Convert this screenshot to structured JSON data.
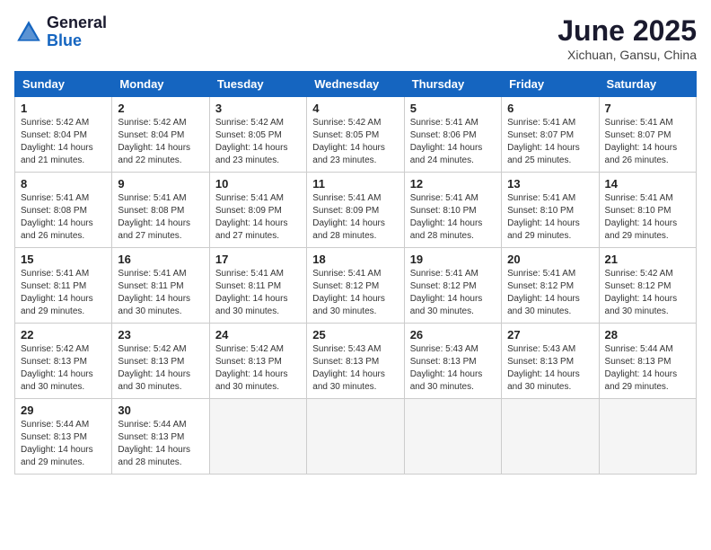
{
  "logo": {
    "general": "General",
    "blue": "Blue"
  },
  "title": "June 2025",
  "location": "Xichuan, Gansu, China",
  "weekdays": [
    "Sunday",
    "Monday",
    "Tuesday",
    "Wednesday",
    "Thursday",
    "Friday",
    "Saturday"
  ],
  "weeks": [
    [
      {
        "day": "1",
        "sunrise": "5:42 AM",
        "sunset": "8:04 PM",
        "daylight": "14 hours and 21 minutes."
      },
      {
        "day": "2",
        "sunrise": "5:42 AM",
        "sunset": "8:04 PM",
        "daylight": "14 hours and 22 minutes."
      },
      {
        "day": "3",
        "sunrise": "5:42 AM",
        "sunset": "8:05 PM",
        "daylight": "14 hours and 23 minutes."
      },
      {
        "day": "4",
        "sunrise": "5:42 AM",
        "sunset": "8:05 PM",
        "daylight": "14 hours and 23 minutes."
      },
      {
        "day": "5",
        "sunrise": "5:41 AM",
        "sunset": "8:06 PM",
        "daylight": "14 hours and 24 minutes."
      },
      {
        "day": "6",
        "sunrise": "5:41 AM",
        "sunset": "8:07 PM",
        "daylight": "14 hours and 25 minutes."
      },
      {
        "day": "7",
        "sunrise": "5:41 AM",
        "sunset": "8:07 PM",
        "daylight": "14 hours and 26 minutes."
      }
    ],
    [
      {
        "day": "8",
        "sunrise": "5:41 AM",
        "sunset": "8:08 PM",
        "daylight": "14 hours and 26 minutes."
      },
      {
        "day": "9",
        "sunrise": "5:41 AM",
        "sunset": "8:08 PM",
        "daylight": "14 hours and 27 minutes."
      },
      {
        "day": "10",
        "sunrise": "5:41 AM",
        "sunset": "8:09 PM",
        "daylight": "14 hours and 27 minutes."
      },
      {
        "day": "11",
        "sunrise": "5:41 AM",
        "sunset": "8:09 PM",
        "daylight": "14 hours and 28 minutes."
      },
      {
        "day": "12",
        "sunrise": "5:41 AM",
        "sunset": "8:10 PM",
        "daylight": "14 hours and 28 minutes."
      },
      {
        "day": "13",
        "sunrise": "5:41 AM",
        "sunset": "8:10 PM",
        "daylight": "14 hours and 29 minutes."
      },
      {
        "day": "14",
        "sunrise": "5:41 AM",
        "sunset": "8:10 PM",
        "daylight": "14 hours and 29 minutes."
      }
    ],
    [
      {
        "day": "15",
        "sunrise": "5:41 AM",
        "sunset": "8:11 PM",
        "daylight": "14 hours and 29 minutes."
      },
      {
        "day": "16",
        "sunrise": "5:41 AM",
        "sunset": "8:11 PM",
        "daylight": "14 hours and 30 minutes."
      },
      {
        "day": "17",
        "sunrise": "5:41 AM",
        "sunset": "8:11 PM",
        "daylight": "14 hours and 30 minutes."
      },
      {
        "day": "18",
        "sunrise": "5:41 AM",
        "sunset": "8:12 PM",
        "daylight": "14 hours and 30 minutes."
      },
      {
        "day": "19",
        "sunrise": "5:41 AM",
        "sunset": "8:12 PM",
        "daylight": "14 hours and 30 minutes."
      },
      {
        "day": "20",
        "sunrise": "5:41 AM",
        "sunset": "8:12 PM",
        "daylight": "14 hours and 30 minutes."
      },
      {
        "day": "21",
        "sunrise": "5:42 AM",
        "sunset": "8:12 PM",
        "daylight": "14 hours and 30 minutes."
      }
    ],
    [
      {
        "day": "22",
        "sunrise": "5:42 AM",
        "sunset": "8:13 PM",
        "daylight": "14 hours and 30 minutes."
      },
      {
        "day": "23",
        "sunrise": "5:42 AM",
        "sunset": "8:13 PM",
        "daylight": "14 hours and 30 minutes."
      },
      {
        "day": "24",
        "sunrise": "5:42 AM",
        "sunset": "8:13 PM",
        "daylight": "14 hours and 30 minutes."
      },
      {
        "day": "25",
        "sunrise": "5:43 AM",
        "sunset": "8:13 PM",
        "daylight": "14 hours and 30 minutes."
      },
      {
        "day": "26",
        "sunrise": "5:43 AM",
        "sunset": "8:13 PM",
        "daylight": "14 hours and 30 minutes."
      },
      {
        "day": "27",
        "sunrise": "5:43 AM",
        "sunset": "8:13 PM",
        "daylight": "14 hours and 30 minutes."
      },
      {
        "day": "28",
        "sunrise": "5:44 AM",
        "sunset": "8:13 PM",
        "daylight": "14 hours and 29 minutes."
      }
    ],
    [
      {
        "day": "29",
        "sunrise": "5:44 AM",
        "sunset": "8:13 PM",
        "daylight": "14 hours and 29 minutes."
      },
      {
        "day": "30",
        "sunrise": "5:44 AM",
        "sunset": "8:13 PM",
        "daylight": "14 hours and 28 minutes."
      },
      null,
      null,
      null,
      null,
      null
    ]
  ]
}
